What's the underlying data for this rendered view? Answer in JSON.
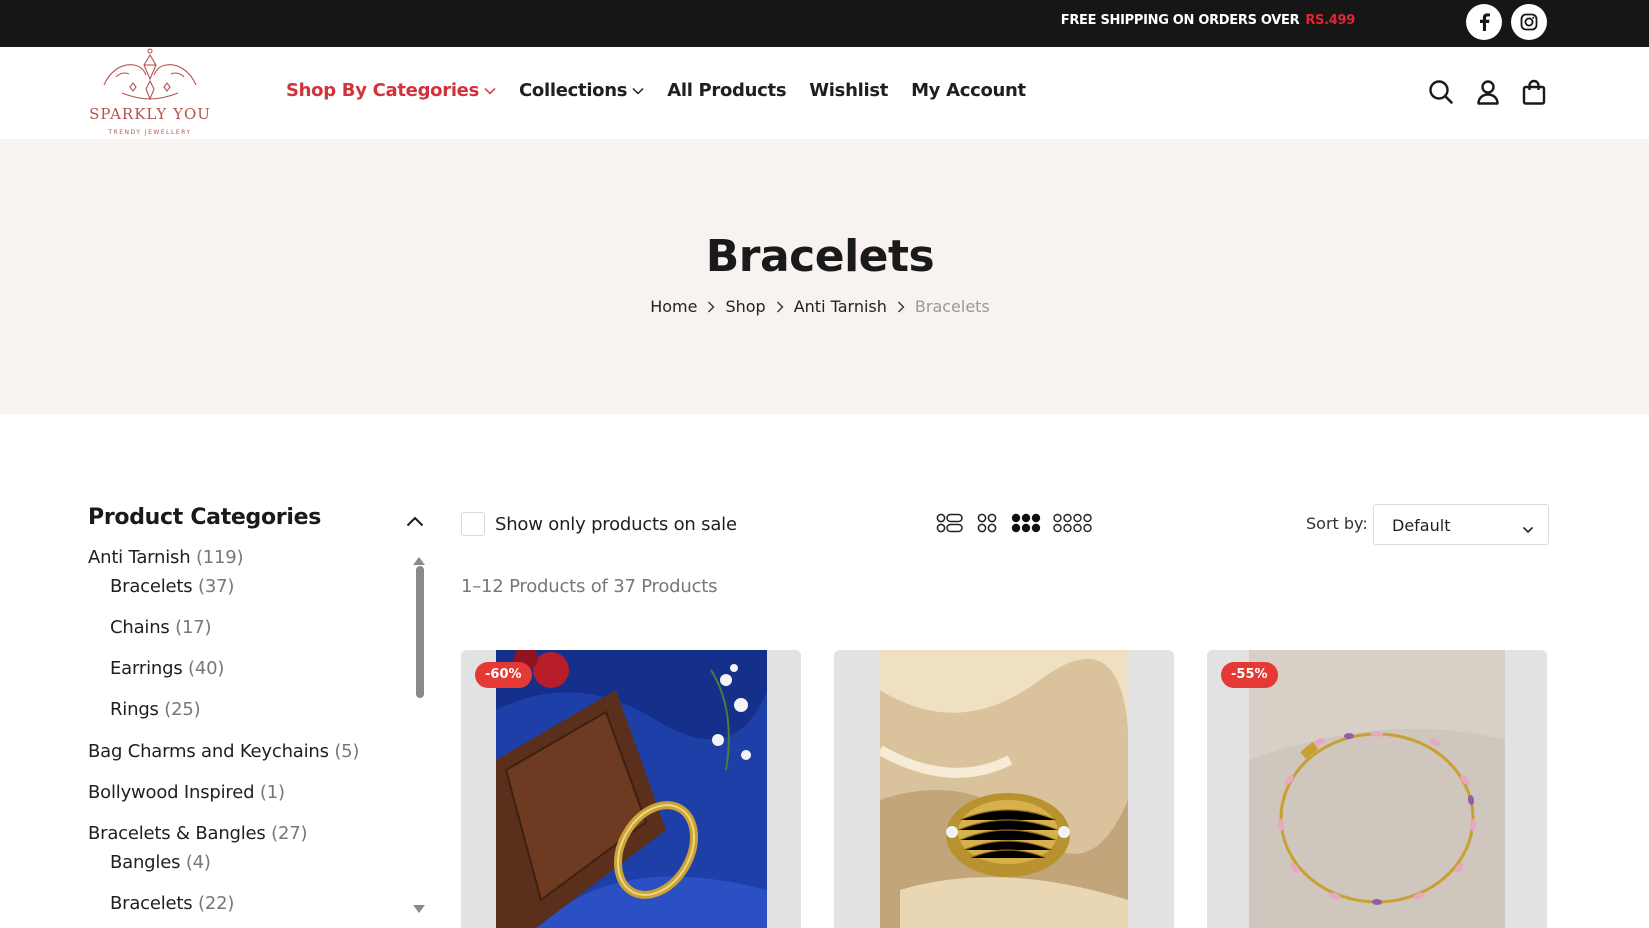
{
  "topbar": {
    "shipping_text": "FREE SHIPPING ON ORDERS OVER",
    "shipping_amount": "RS.499",
    "social": [
      "facebook-icon",
      "instagram-icon"
    ]
  },
  "header": {
    "logo_name": "SPARKLY YOU",
    "logo_tagline": "TRENDY JEWELLERY",
    "nav": [
      {
        "label": "Shop By Categories",
        "dropdown": true,
        "active": true
      },
      {
        "label": "Collections",
        "dropdown": true,
        "active": false
      },
      {
        "label": "All Products",
        "dropdown": false,
        "active": false
      },
      {
        "label": "Wishlist",
        "dropdown": false,
        "active": false
      },
      {
        "label": "My Account",
        "dropdown": false,
        "active": false
      }
    ],
    "icons": [
      "search-icon",
      "user-icon",
      "bag-icon"
    ]
  },
  "hero": {
    "title": "Bracelets",
    "breadcrumb": [
      "Home",
      "Shop",
      "Anti Tarnish",
      "Bracelets"
    ]
  },
  "sidebar": {
    "title": "Product Categories",
    "categories": [
      {
        "label": "Anti Tarnish",
        "count": "(119)",
        "level": 0
      },
      {
        "label": "Bracelets",
        "count": "(37)",
        "level": 1
      },
      {
        "label": "Chains",
        "count": "(17)",
        "level": 1
      },
      {
        "label": "Earrings",
        "count": "(40)",
        "level": 1
      },
      {
        "label": "Rings",
        "count": "(25)",
        "level": 1
      },
      {
        "label": "Bag Charms and Keychains",
        "count": "(5)",
        "level": 0
      },
      {
        "label": "Bollywood Inspired",
        "count": "(1)",
        "level": 0
      },
      {
        "label": "Bracelets & Bangles",
        "count": "(27)",
        "level": 0
      },
      {
        "label": "Bangles",
        "count": "(4)",
        "level": 1
      },
      {
        "label": "Bracelets",
        "count": "(22)",
        "level": 1
      }
    ]
  },
  "toolbar": {
    "on_sale_label": "Show only products on sale",
    "view_modes": [
      "list-view-icon",
      "grid-2-icon",
      "grid-3-icon",
      "grid-4-icon"
    ],
    "active_view": "grid-3-icon",
    "sort_label": "Sort by:",
    "sort_value": "Default",
    "result_count": "1–12 Products of 37 Products"
  },
  "products": [
    {
      "badge": "-60%",
      "image": "gold-bangle-on-blue-satin"
    },
    {
      "badge": "",
      "image": "gold-cuff-on-champagne-satin"
    },
    {
      "badge": "-55%",
      "image": "pink-crystal-bracelet"
    }
  ],
  "colors": {
    "accent": "#d2333a",
    "topbar": "#161616",
    "hero_bg": "#f8f3f0",
    "badge": "#e53935"
  }
}
